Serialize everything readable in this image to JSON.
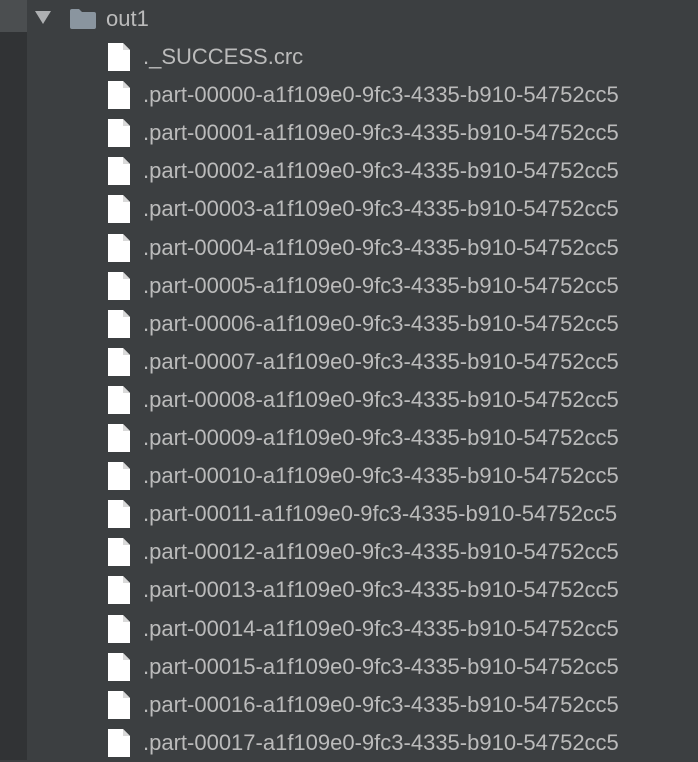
{
  "colors": {
    "background": "#3c3f41",
    "gutter": "#313335",
    "text": "#bbbbbb",
    "folder_icon": "#8a959f",
    "file_icon": "#ffffff"
  },
  "tree": {
    "folder": {
      "name": "out1",
      "expanded": true,
      "icon": "folder-icon",
      "expand_icon": "chevron-down-icon"
    },
    "files": [
      {
        "name": "._SUCCESS.crc",
        "icon": "file-icon"
      },
      {
        "name": ".part-00000-a1f109e0-9fc3-4335-b910-54752cc5",
        "icon": "file-icon"
      },
      {
        "name": ".part-00001-a1f109e0-9fc3-4335-b910-54752cc5",
        "icon": "file-icon"
      },
      {
        "name": ".part-00002-a1f109e0-9fc3-4335-b910-54752cc5",
        "icon": "file-icon"
      },
      {
        "name": ".part-00003-a1f109e0-9fc3-4335-b910-54752cc5",
        "icon": "file-icon"
      },
      {
        "name": ".part-00004-a1f109e0-9fc3-4335-b910-54752cc5",
        "icon": "file-icon"
      },
      {
        "name": ".part-00005-a1f109e0-9fc3-4335-b910-54752cc5",
        "icon": "file-icon"
      },
      {
        "name": ".part-00006-a1f109e0-9fc3-4335-b910-54752cc5",
        "icon": "file-icon"
      },
      {
        "name": ".part-00007-a1f109e0-9fc3-4335-b910-54752cc5",
        "icon": "file-icon"
      },
      {
        "name": ".part-00008-a1f109e0-9fc3-4335-b910-54752cc5",
        "icon": "file-icon"
      },
      {
        "name": ".part-00009-a1f109e0-9fc3-4335-b910-54752cc5",
        "icon": "file-icon"
      },
      {
        "name": ".part-00010-a1f109e0-9fc3-4335-b910-54752cc5",
        "icon": "file-icon"
      },
      {
        "name": ".part-00011-a1f109e0-9fc3-4335-b910-54752cc5",
        "icon": "file-icon"
      },
      {
        "name": ".part-00012-a1f109e0-9fc3-4335-b910-54752cc5",
        "icon": "file-icon"
      },
      {
        "name": ".part-00013-a1f109e0-9fc3-4335-b910-54752cc5",
        "icon": "file-icon"
      },
      {
        "name": ".part-00014-a1f109e0-9fc3-4335-b910-54752cc5",
        "icon": "file-icon"
      },
      {
        "name": ".part-00015-a1f109e0-9fc3-4335-b910-54752cc5",
        "icon": "file-icon"
      },
      {
        "name": ".part-00016-a1f109e0-9fc3-4335-b910-54752cc5",
        "icon": "file-icon"
      },
      {
        "name": ".part-00017-a1f109e0-9fc3-4335-b910-54752cc5",
        "icon": "file-icon"
      }
    ]
  }
}
